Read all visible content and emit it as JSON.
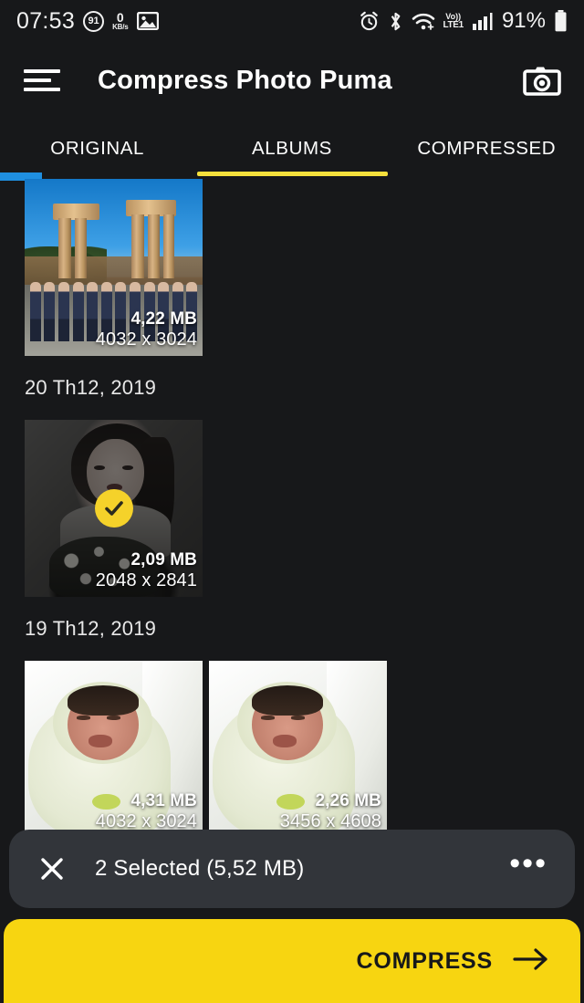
{
  "status_bar": {
    "time": "07:53",
    "notification_count": "91",
    "network_speed_value": "0",
    "network_speed_unit": "KB/s",
    "gallery_icon": "image-icon",
    "alarm_icon": "alarm-icon",
    "bluetooth_icon": "bluetooth-icon",
    "wifi_icon": "wifi-icon",
    "volte_label_top": "Vo))",
    "volte_label_bottom": "LTE1",
    "signal_icon": "signal-bars-icon",
    "battery_percent": "91%",
    "battery_icon": "battery-icon"
  },
  "app_bar": {
    "menu_icon": "hamburger-menu-icon",
    "title": "Compress Photo Puma",
    "camera_icon": "camera-icon"
  },
  "tabs": {
    "items": [
      {
        "label": "ORIGINAL",
        "active": false
      },
      {
        "label": "ALBUMS",
        "active": true
      },
      {
        "label": "COMPRESSED",
        "active": false
      }
    ],
    "indicator_color": "#f5e03c"
  },
  "groups": [
    {
      "date": "",
      "photos": [
        {
          "art": "ph-temple",
          "size": "4,22 MB",
          "dimensions": "4032 x 3024",
          "selected": false,
          "alt": "group photo in front of classical columned building"
        }
      ]
    },
    {
      "date": "20 Th12, 2019",
      "photos": [
        {
          "art": "ph-portrait",
          "size": "2,09 MB",
          "dimensions": "2048 x 2841",
          "selected": true,
          "alt": "portrait of a woman holding a bouquet"
        }
      ]
    },
    {
      "date": "19 Th12, 2019",
      "photos": [
        {
          "art": "ph-baby",
          "size": "4,31 MB",
          "dimensions": "4032 x 3024",
          "selected": false,
          "alt": "newborn baby wrapped in a blanket"
        },
        {
          "art": "ph-baby",
          "size": "2,26 MB",
          "dimensions": "3456 x 4608",
          "selected": false,
          "alt": "newborn baby wrapped in a blanket"
        }
      ]
    }
  ],
  "selection_bar": {
    "close_icon": "close-icon",
    "text": "2 Selected (5,52 MB)",
    "overflow_icon": "more-options-icon",
    "background_color": "#32353a"
  },
  "compress_button": {
    "label": "COMPRESS",
    "arrow_icon": "arrow-right-icon",
    "background_color": "#f7d511"
  }
}
